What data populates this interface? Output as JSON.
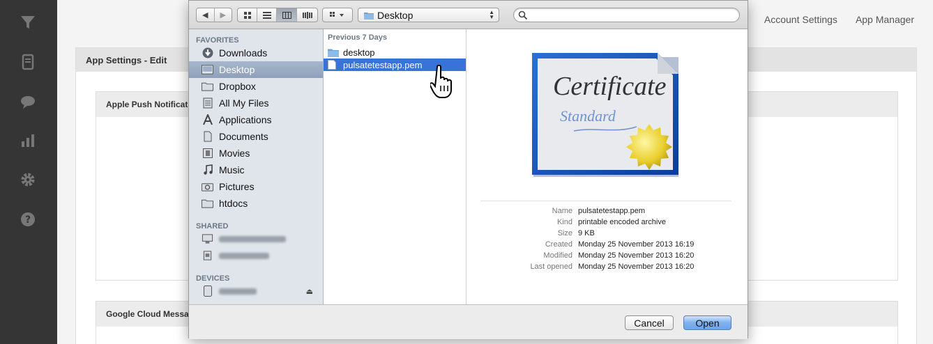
{
  "topnav": {
    "account_settings": "Account Settings",
    "app_manager": "App Manager"
  },
  "page": {
    "title": "App Settings - Edit",
    "section_apns": "Apple Push Notificatio",
    "section_gcm": "Google Cloud Messaging (GCM)"
  },
  "leftnav": {
    "icons": [
      "filter-icon",
      "device-icon",
      "chat-icon",
      "bar-chart-icon",
      "gear-icon",
      "help-icon"
    ]
  },
  "dialog": {
    "path": "Desktop",
    "search": {
      "placeholder": ""
    },
    "sidebar": {
      "favorites_label": "FAVORITES",
      "favorites": [
        "Downloads",
        "Desktop",
        "Dropbox",
        "All My Files",
        "Applications",
        "Documents",
        "Movies",
        "Music",
        "Pictures",
        "htdocs"
      ],
      "selected": "Desktop",
      "shared_label": "SHARED",
      "devices_label": "DEVICES"
    },
    "column": {
      "header": "Previous 7 Days",
      "items": [
        "desktop",
        "pulsatetestapp.pem"
      ],
      "selected": "pulsatetestapp.pem"
    },
    "preview": {
      "name_label": "Name",
      "name": "pulsatetestapp.pem",
      "kind_label": "Kind",
      "kind": "printable encoded archive",
      "size_label": "Size",
      "size": "9 KB",
      "created_label": "Created",
      "created": "Monday 25 November 2013 16:19",
      "modified_label": "Modified",
      "modified": "Monday 25 November 2013 16:20",
      "opened_label": "Last opened",
      "opened": "Monday 25 November 2013 16:20"
    },
    "buttons": {
      "cancel": "Cancel",
      "open": "Open"
    },
    "accent": "#3874d8"
  }
}
